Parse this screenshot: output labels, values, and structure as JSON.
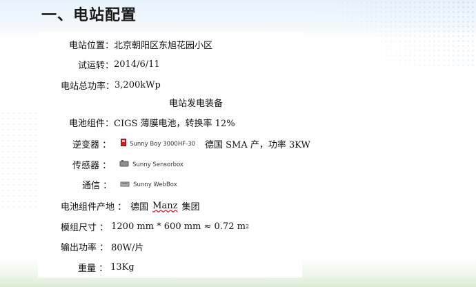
{
  "slide": {
    "title": "一、电站配置",
    "location": {
      "label": "电站位置：",
      "value": "北京朝阳区东旭花园小区"
    },
    "trial_run": {
      "label": "试运转：",
      "value": "2014/6/11"
    },
    "total_power": {
      "label": "电站总功率：",
      "value": "3,200kWp"
    },
    "equipment_heading": "电站发电装备",
    "module": {
      "label": "电池组件：",
      "value": "CIGS 薄膜电池，转换率 12%"
    },
    "inverter": {
      "label": "逆变器 ：",
      "device": "Sunny Boy 3000HF-30",
      "note": "德国 SMA 产，功率 3KW"
    },
    "sensor": {
      "label": "传感器 ：",
      "device": "Sunny Sensorbox"
    },
    "comm": {
      "label": "通信 ：",
      "device": "Sunny WebBox"
    },
    "origin": {
      "label": "电池组件产地 ：",
      "prefix": "德国",
      "brand": "Manz",
      "suffix": "集团"
    },
    "module_size": {
      "label": "模组尺寸 ：",
      "value": "1200 mm * 600 mm ≈ 0.72 m",
      "sup": "2"
    },
    "output": {
      "label": "输出功率 ：",
      "value": "80W/片"
    },
    "weight": {
      "label": "重量 ：",
      "value": "13Kg"
    }
  }
}
